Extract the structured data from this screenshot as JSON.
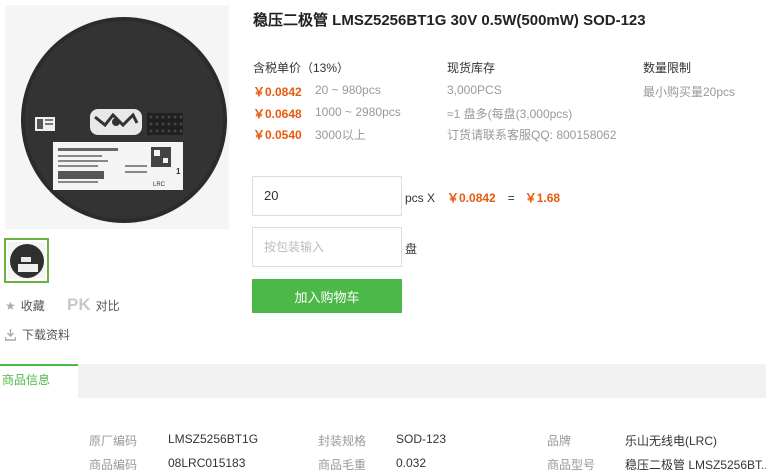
{
  "product": {
    "title": "稳压二极管 LMSZ5256BT1G 30V 0.5W(500mW) SOD-123"
  },
  "price_section": {
    "header": "含税单价（13%）",
    "tiers": [
      {
        "price": "￥0.0842",
        "qty": "20 ~ 980pcs"
      },
      {
        "price": "￥0.0648",
        "qty": "1000 ~ 2980pcs"
      },
      {
        "price": "￥0.0540",
        "qty": "3000以上"
      }
    ]
  },
  "stock_section": {
    "header": "现货库存",
    "lines": [
      "3,000PCS",
      "≈1 盘多(每盘(3,000pcs)",
      "订货请联系客服QQ: 800158062"
    ]
  },
  "limit_section": {
    "header": "数量限制",
    "text": "最小购买量20pcs"
  },
  "quantity": {
    "value": "20",
    "unit": "pcs X",
    "unit_price": "￥0.0842",
    "equals": "=",
    "total": "￥1.68"
  },
  "package": {
    "placeholder": "按包装输入",
    "unit": "盘"
  },
  "cart_button": "加入购物车",
  "sidebar": {
    "favorite": "收藏",
    "compare_badge": "PK",
    "compare": "对比",
    "download": "下载资料"
  },
  "tabs": {
    "active": "商品信息"
  },
  "specs": [
    {
      "label": "原厂编码",
      "value": "LMSZ5256BT1G"
    },
    {
      "label": "封装规格",
      "value": "SOD-123"
    },
    {
      "label": "品牌",
      "value": "乐山无线电(LRC)"
    },
    {
      "label": "商品编码",
      "value": "08LRC015183"
    },
    {
      "label": "商品毛重",
      "value": "0.032"
    },
    {
      "label": "商品型号",
      "value": "稳压二极管 LMSZ5256BT..."
    }
  ],
  "reel_label": {
    "model_text": "LMSZ5256BT1G",
    "brand_text": "LRC",
    "qty_text": "1"
  },
  "colors": {
    "accent_green": "#4cb848",
    "price_orange": "#e8590c"
  },
  "icons": [
    "star-icon",
    "download-icon"
  ]
}
